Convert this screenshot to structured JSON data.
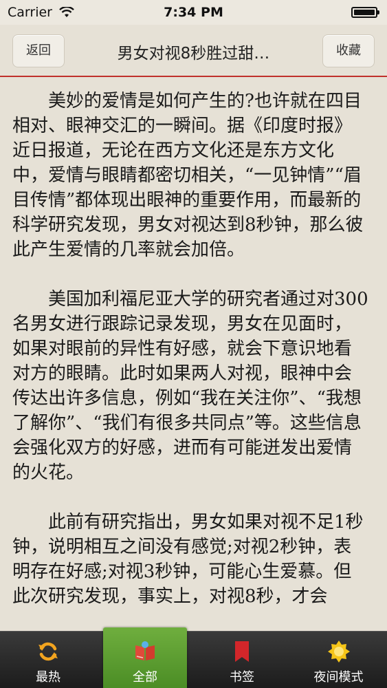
{
  "status_bar": {
    "carrier": "Carrier",
    "time": "7:34 PM",
    "wifi_icon": "wifi-icon",
    "battery_icon": "battery-icon",
    "battery_level": 1.0
  },
  "nav": {
    "back_label": "返回",
    "title": "男女对视8秒胜过甜…",
    "favorite_label": "收藏",
    "divider_color": "#c0302b"
  },
  "article": {
    "paragraphs": [
      "美妙的爱情是如何产生的?也许就在四目相对、眼神交汇的一瞬间。据《印度时报》近日报道，无论在西方文化还是东方文化中，爱情与眼睛都密切相关，“一见钟情”“眉目传情”都体现出眼神的重要作用，而最新的科学研究发现，男女对视达到8秒钟，那么彼此产生爱情的几率就会加倍。",
      "美国加利福尼亚大学的研究者通过对300名男女进行跟踪记录发现，男女在见面时，如果对眼前的异性有好感，就会下意识地看对方的眼睛。此时如果两人对视，眼神中会传达出许多信息，例如“我在关注你”、“我想了解你”、“我们有很多共同点”等。这些信息会强化双方的好感，进而有可能迸发出爱情的火花。",
      "此前有研究指出，男女如果对视不足1秒钟，说明相互之间没有感觉;对视2秒钟，表明存在好感;对视3秒钟，可能心生爱慕。但此次研究发现，事实上，对视8秒，才会"
    ]
  },
  "tab_bar": {
    "active_color": "#5a9c30",
    "tabs": [
      {
        "label": "最热",
        "icon": "refresh-icon"
      },
      {
        "label": "全部",
        "icon": "book-icon",
        "active": true
      },
      {
        "label": "书签",
        "icon": "bookmark-icon"
      },
      {
        "label": "夜间模式",
        "icon": "sun-icon"
      }
    ]
  }
}
